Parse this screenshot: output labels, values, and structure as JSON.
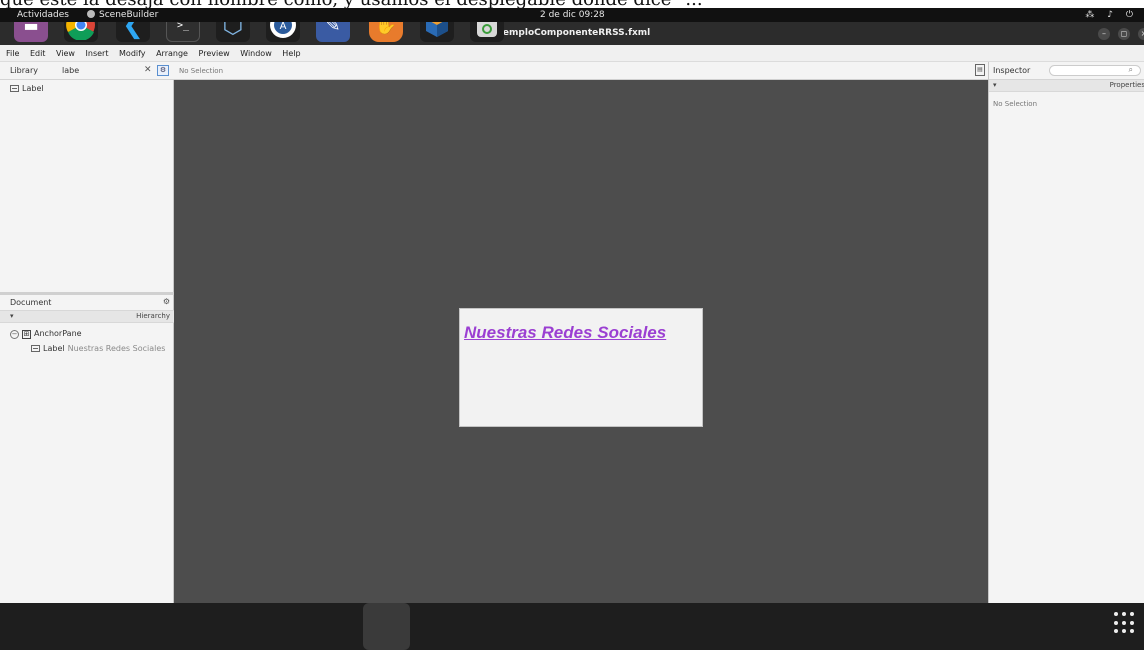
{
  "caption": "que esté la desaja con nombre como, y usamos el desplegable donde dice \"...",
  "topbar": {
    "activities": "Actividades",
    "app_name": "SceneBuilder",
    "clock": "2 de dic  09:28",
    "tray": "⁂ ♪ ⏻"
  },
  "window": {
    "title": "EjemploComponenteRRSS.fxml"
  },
  "menu": [
    "File",
    "Edit",
    "View",
    "Insert",
    "Modify",
    "Arrange",
    "Preview",
    "Window",
    "Help"
  ],
  "library": {
    "title": "Library",
    "search_value": "labe",
    "items": [
      {
        "label": "Label"
      }
    ]
  },
  "document": {
    "title": "Document",
    "hierarchy_label": "Hierarchy",
    "tree": {
      "root": "AnchorPane",
      "child_type": "Label",
      "child_text": "Nuestras Redes Sociales"
    }
  },
  "canvas": {
    "selection_status": "No Selection",
    "label_text": "Nuestras Redes Sociales",
    "label_color": "#9b3fd2"
  },
  "inspector": {
    "title": "Inspector",
    "properties_label": "Properties",
    "empty_text": "No Selection"
  },
  "dock": [
    "files-icon",
    "chrome-icon",
    "vscode-icon",
    "terminal-icon",
    "virtualbox-icon",
    "software-icon",
    "text-editor-icon",
    "scenebuilder-icon",
    "netbeans-icon",
    "trash-icon",
    "app-grid-icon"
  ]
}
